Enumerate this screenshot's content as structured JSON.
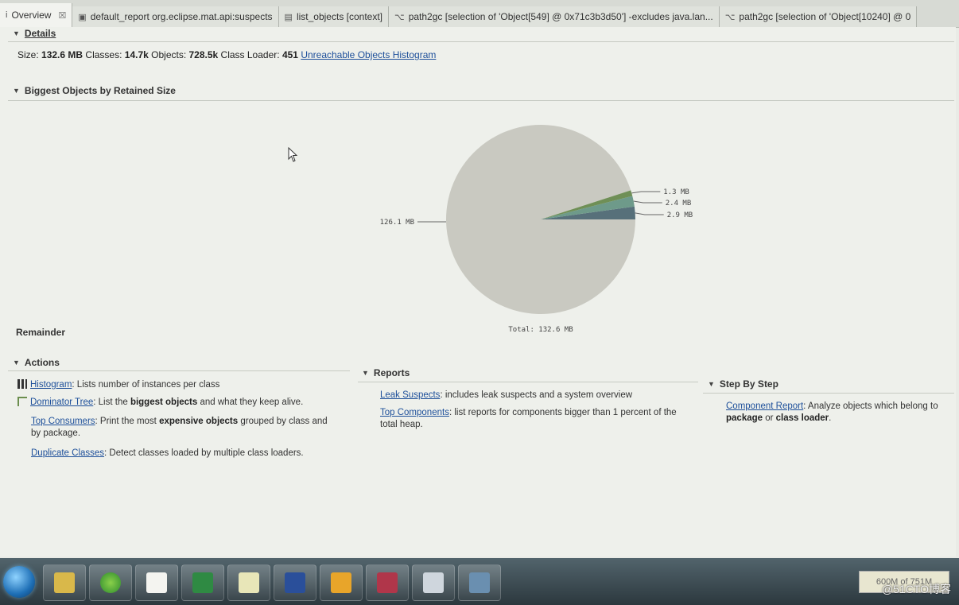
{
  "tabs": [
    {
      "icon": "info-icon",
      "label": "Overview",
      "active": true,
      "closable": true
    },
    {
      "icon": "report-icon",
      "label": "default_report  org.eclipse.mat.api:suspects"
    },
    {
      "icon": "document-icon",
      "label": "list_objects [context]"
    },
    {
      "icon": "path-icon",
      "label": "path2gc [selection of 'Object[549] @ 0x71c3b3d50'] -excludes java.lan..."
    },
    {
      "icon": "path-icon",
      "label": "path2gc [selection of 'Object[10240] @ 0"
    }
  ],
  "details": {
    "title": "Details",
    "size_label": "Size:",
    "size_value": "132.6 MB",
    "classes_label": "Classes:",
    "classes_value": "14.7k",
    "objects_label": "Objects:",
    "objects_value": "728.5k",
    "classloader_label": "Class Loader:",
    "classloader_value": "451",
    "unreachable_link": "Unreachable Objects Histogram"
  },
  "biggest": {
    "title": "Biggest Objects by Retained Size",
    "remainder_label": "Remainder"
  },
  "chart_data": {
    "type": "pie",
    "values": [
      126.1,
      2.9,
      2.4,
      1.3
    ],
    "labels": [
      "126.1 MB",
      "2.9 MB",
      "2.4 MB",
      "1.3 MB"
    ],
    "colors": [
      "#c9c9c1",
      "#57707a",
      "#6e9a8a",
      "#6f8f56"
    ],
    "total_label": "Total: 132.6 MB"
  },
  "actions": {
    "title": "Actions",
    "histogram_link": "Histogram",
    "histogram_desc": ": Lists number of instances per class",
    "dominator_link": "Dominator Tree",
    "dominator_desc1": ": List the ",
    "dominator_bold": "biggest objects",
    "dominator_desc2": " and what they keep alive.",
    "topconsumers_link": "Top Consumers",
    "topconsumers_desc1": ": Print the most ",
    "topconsumers_bold": "expensive objects",
    "topconsumers_desc2": " grouped by class and by package.",
    "duplicate_link": "Duplicate Classes",
    "duplicate_desc": ": Detect classes loaded by multiple class loaders."
  },
  "reports": {
    "title": "Reports",
    "leak_link": "Leak Suspects",
    "leak_desc": ": includes leak suspects and a system overview",
    "topcomp_link": "Top Components",
    "topcomp_desc": ": list reports for components bigger than 1 percent of the total heap."
  },
  "stepbystep": {
    "title": "Step By Step",
    "component_link": "Component Report",
    "component_desc": ": Analyze objects which belong to",
    "bold1": "package",
    "or": " or ",
    "bold2": "class loader",
    "period": "."
  },
  "taskbar": {
    "tray_text": "600M of 751M",
    "watermark": "@51CTO博客"
  }
}
